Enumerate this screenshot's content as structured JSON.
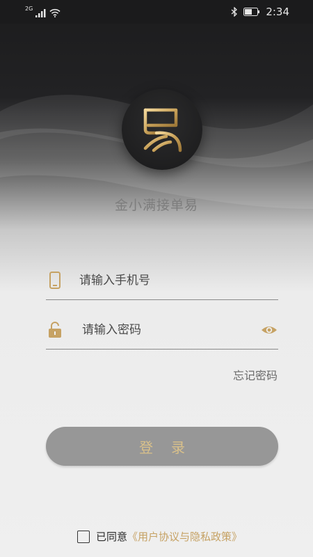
{
  "status_bar": {
    "network": "2G",
    "time": "2:34",
    "icons": [
      "signal-icon",
      "wifi-icon",
      "bluetooth-icon",
      "battery-icon"
    ]
  },
  "app": {
    "name": "金小满接单易",
    "logo_icon": "yi-logo-icon"
  },
  "form": {
    "phone_placeholder": "请输入手机号",
    "phone_icon": "phone-icon",
    "password_placeholder": "请输入密码",
    "password_icon": "lock-icon",
    "eye_icon": "eye-icon",
    "forgot_label": "忘记密码",
    "login_label": "登录"
  },
  "agreement": {
    "prefix": "已同意",
    "link_text": "《用户协议与隐私政策》",
    "checked": false
  },
  "colors": {
    "accent_gold": "#c6a264",
    "button_bg": "#979797",
    "button_text": "#d9c08a",
    "status_bar_bg": "#1b1b1c"
  }
}
